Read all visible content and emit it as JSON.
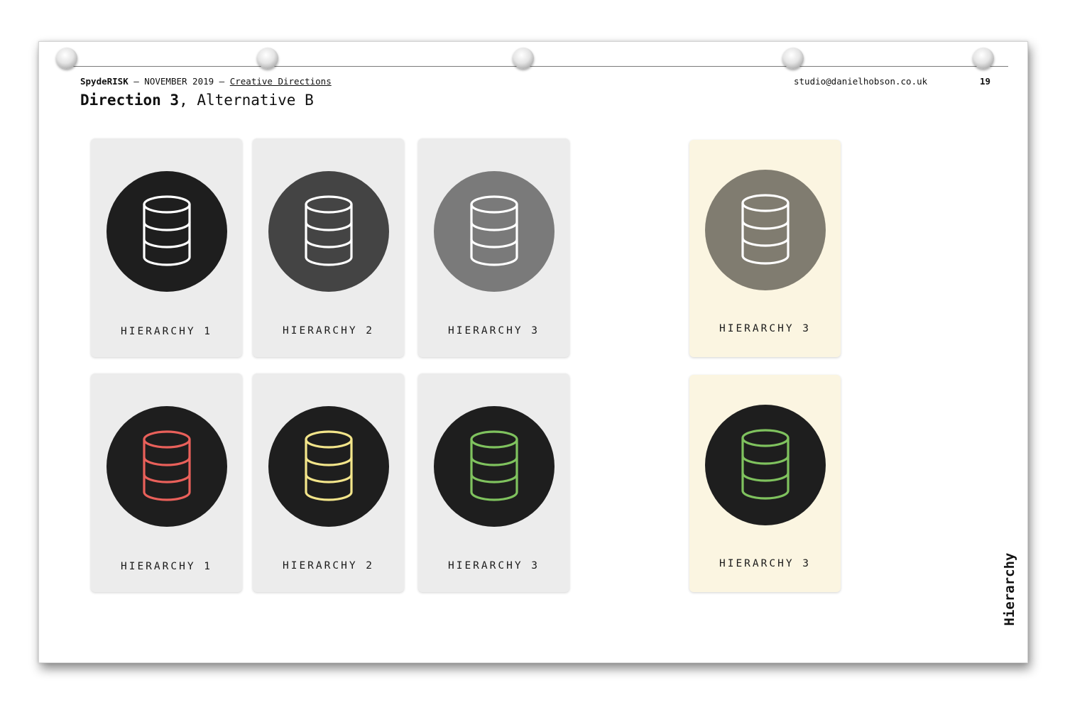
{
  "header": {
    "brand": "SpydeRISK",
    "date": " — NOVEMBER 2019 — ",
    "section": "Creative Directions",
    "email": "studio@danielhobson.co.uk",
    "page_number": "19"
  },
  "title": {
    "bold": "Direction 3",
    "rest": ", Alternative B"
  },
  "side_label": "Hierarchy",
  "cards": [
    {
      "label": "HIERARCHY 1",
      "background": "#ececec",
      "circle_color": "#1e1e1e",
      "icon_color": "#ffffff",
      "icon": "database-icon"
    },
    {
      "label": "HIERARCHY 2",
      "background": "#ececec",
      "circle_color": "#444444",
      "icon_color": "#ffffff",
      "icon": "database-icon"
    },
    {
      "label": "HIERARCHY 3",
      "background": "#ececec",
      "circle_color": "#7a7a7a",
      "icon_color": "#ffffff",
      "icon": "database-icon"
    },
    {
      "label": "HIERARCHY 3",
      "background": "#fbf5e1",
      "circle_color": "#807c70",
      "icon_color": "#ffffff",
      "icon": "database-icon"
    },
    {
      "label": "HIERARCHY 1",
      "background": "#ececec",
      "circle_color": "#1e1e1e",
      "icon_color": "#e9605a",
      "icon": "database-icon"
    },
    {
      "label": "HIERARCHY 2",
      "background": "#ececec",
      "circle_color": "#1e1e1e",
      "icon_color": "#f3e58a",
      "icon": "database-icon"
    },
    {
      "label": "HIERARCHY 3",
      "background": "#ececec",
      "circle_color": "#1e1e1e",
      "icon_color": "#7fc25e",
      "icon": "database-icon"
    },
    {
      "label": "HIERARCHY 3",
      "background": "#fbf5e1",
      "circle_color": "#1e1e1e",
      "icon_color": "#7fc25e",
      "icon": "database-icon"
    }
  ]
}
